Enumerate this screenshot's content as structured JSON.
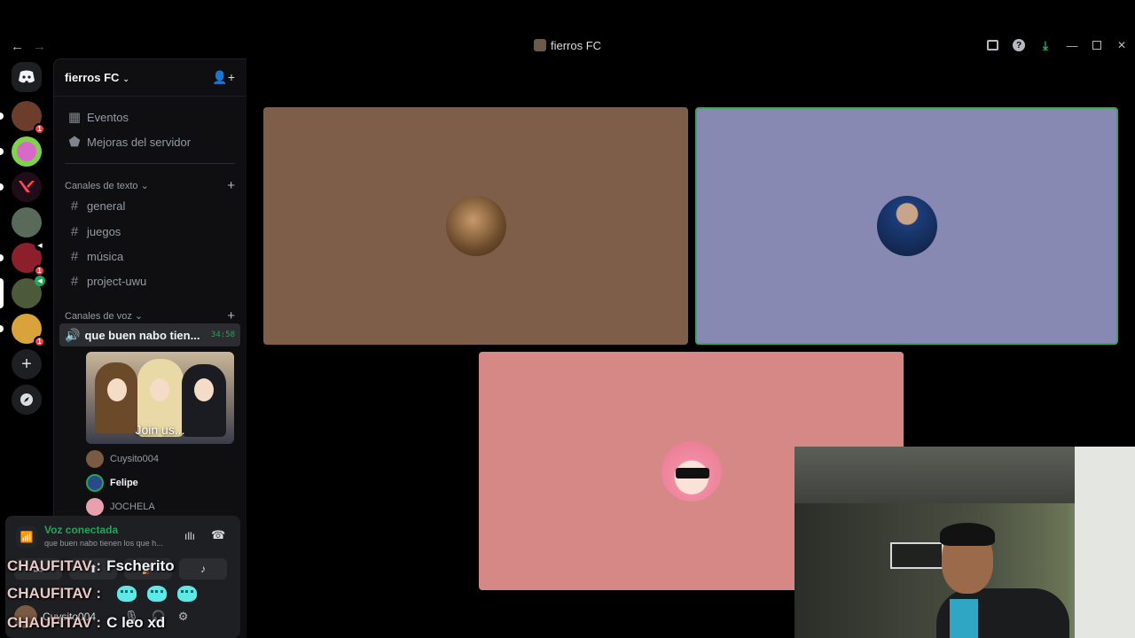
{
  "window": {
    "title": "fierros FC",
    "back": "←",
    "forward": "→"
  },
  "rail": {
    "discord_home": "discord-home",
    "servers": [
      {
        "name": "server-1",
        "badge": "1",
        "color": "#6b3d2a"
      },
      {
        "name": "server-2",
        "badge": "",
        "color": "#7fd24a"
      },
      {
        "name": "server-valorant",
        "badge": "",
        "color": "#ff4655"
      },
      {
        "name": "server-4",
        "badge": "",
        "color": "#5a6a5a"
      },
      {
        "name": "server-5",
        "badge": "1",
        "color": "#8c1f2c"
      },
      {
        "name": "server-6",
        "badge": "",
        "color": "#4d5a3a"
      },
      {
        "name": "server-7",
        "badge": "1",
        "color": "#d9a23a"
      }
    ],
    "add_server": "+",
    "explore": "explore"
  },
  "server": {
    "name": "fierros FC",
    "events": "Eventos",
    "boosts": "Mejoras del servidor",
    "text_category": "Canales de texto",
    "text_channels": [
      "general",
      "juegos",
      "música",
      "project-uwu"
    ],
    "voice_category": "Canales de voz",
    "voice_channel": {
      "name": "que buen nabo tien...",
      "time": "34:58"
    },
    "activity_label": "Join us...",
    "participants": [
      {
        "name": "Cuysito004",
        "active": false,
        "color": "#7a5a40"
      },
      {
        "name": "Felipe",
        "active": true,
        "color": "#2b4a8c"
      },
      {
        "name": "JOCHELA",
        "active": false,
        "color": "#e8a0ae"
      }
    ]
  },
  "voice_panel": {
    "title": "Voz conectada",
    "subtitle": "que buen nabo tienen los que h...",
    "username": "Cuysito004"
  },
  "overlay": {
    "line1_user": "CHAUFITAV :",
    "line1_text": "Fscherito",
    "line2_user": "CHAUFITAV :",
    "line3_user": "CHAUFITAV :",
    "line3_text": "C leo xd"
  },
  "tiles": [
    {
      "name": "tile-cuysito004",
      "bg": "#7e5e49",
      "avatar": "#8a6a4a"
    },
    {
      "name": "tile-felipe",
      "bg": "#8889b2",
      "avatar": "#1c3c7a",
      "speaking": true
    },
    {
      "name": "tile-jochela",
      "bg": "#d68887",
      "avatar": "#f0a8b8"
    }
  ]
}
